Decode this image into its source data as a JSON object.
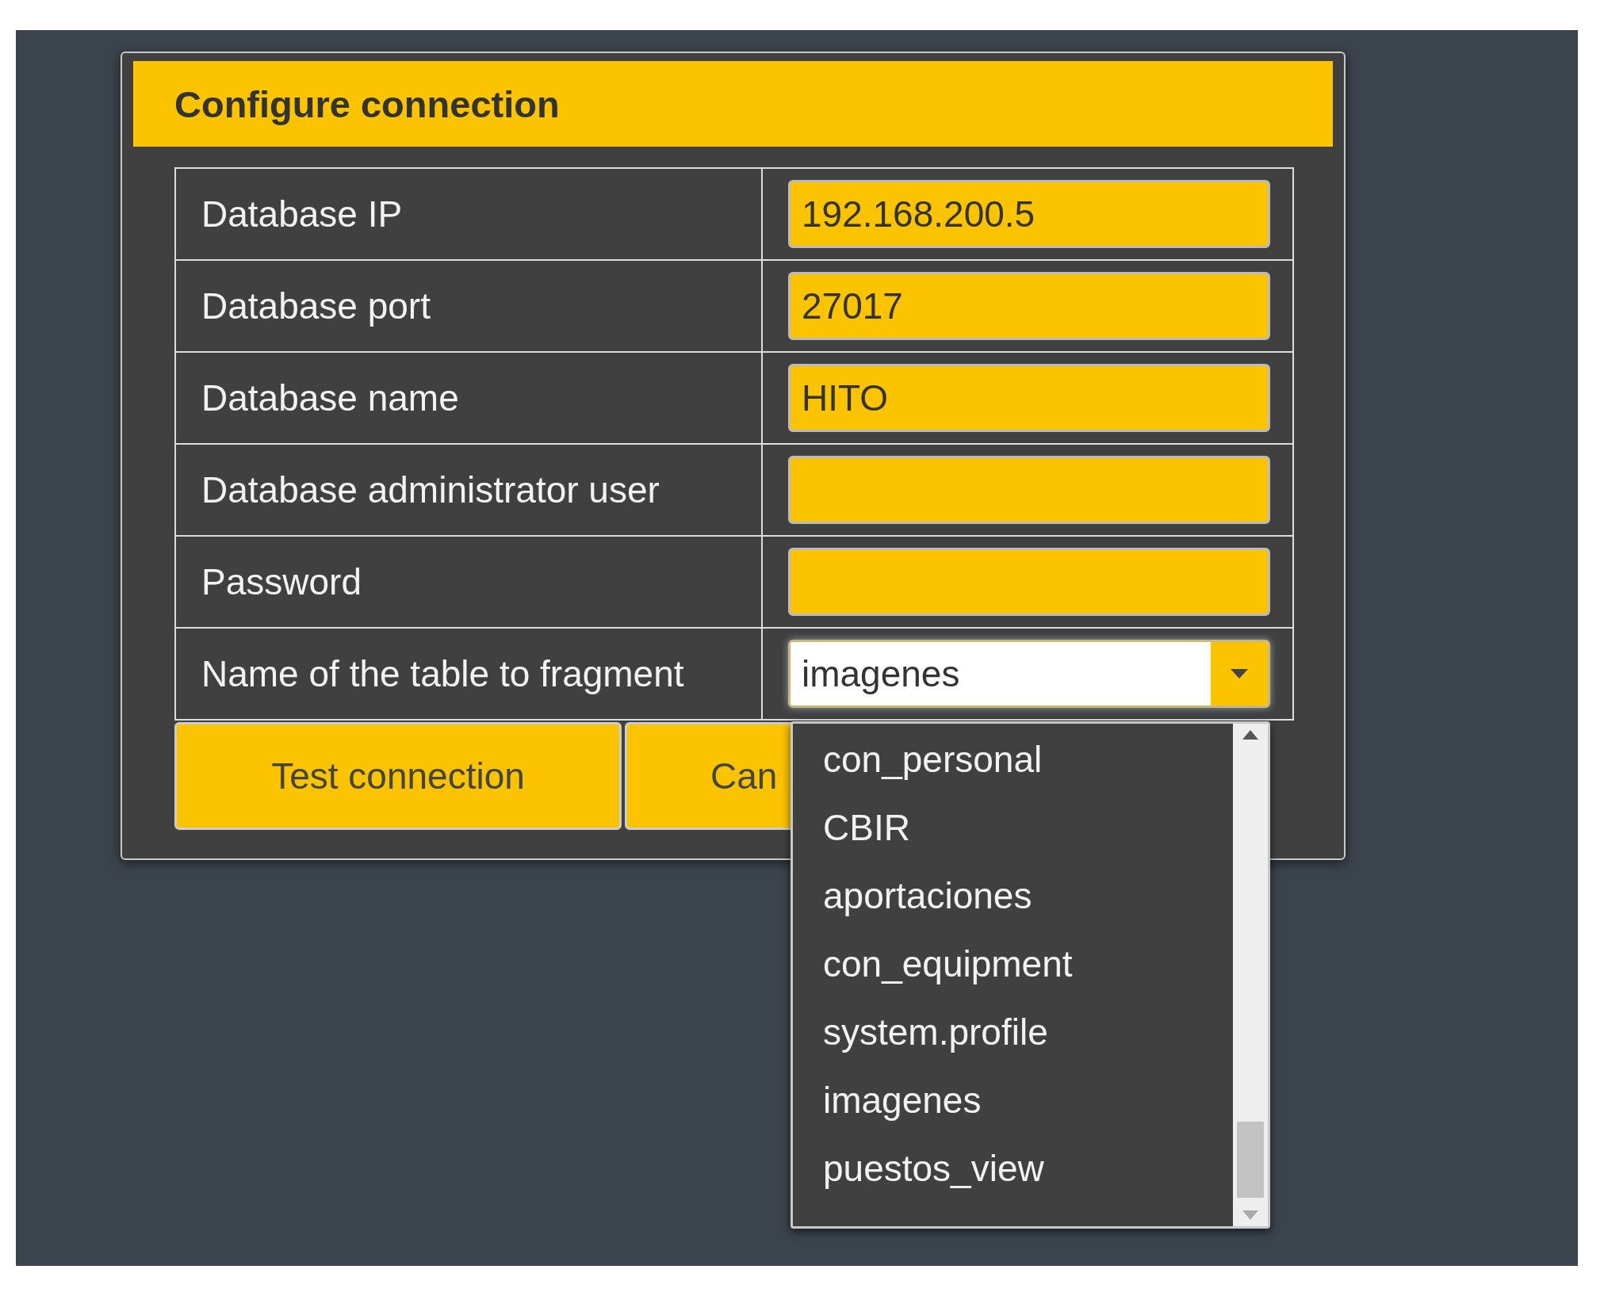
{
  "dialog": {
    "title": "Configure connection",
    "fields": [
      {
        "label": "Database IP",
        "value": "192.168.200.5",
        "kind": "text"
      },
      {
        "label": "Database port",
        "value": "27017",
        "kind": "text"
      },
      {
        "label": "Database name",
        "value": "HITO",
        "kind": "text"
      },
      {
        "label": "Database administrator user",
        "kind": "text"
      },
      {
        "label": "Password",
        "kind": "password"
      },
      {
        "label": "Name of the table to fragment",
        "value": "imagenes",
        "kind": "select"
      }
    ],
    "buttons": [
      "Test connection",
      "Can"
    ]
  },
  "dropdown": {
    "options": [
      {
        "label": "con_personal",
        "selected": false
      },
      {
        "label": "CBIR",
        "selected": false
      },
      {
        "label": "aportaciones",
        "selected": false
      },
      {
        "label": "con_equipment",
        "selected": false
      },
      {
        "label": "system.profile",
        "selected": false
      },
      {
        "label": "imagenes",
        "selected": false
      },
      {
        "label": "puestos_view",
        "selected": false
      }
    ]
  }
}
